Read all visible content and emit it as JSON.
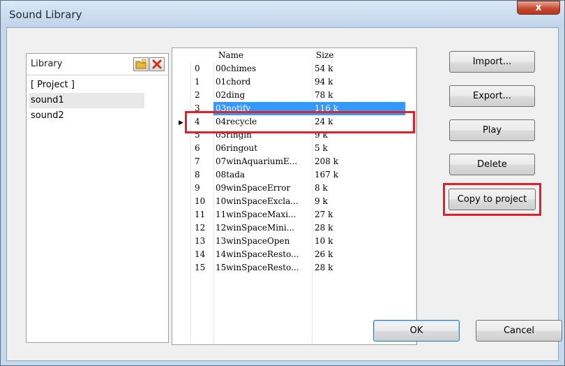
{
  "window": {
    "title": "Sound Library",
    "close_label": "x"
  },
  "library": {
    "title": "Library",
    "items": [
      "[ Project ]",
      "sound1",
      "sound2"
    ],
    "selected_index": 1
  },
  "grid": {
    "columns": [
      "Name",
      "Size"
    ],
    "selected_index": 3,
    "rows": [
      {
        "idx": "0",
        "name": "00chimes",
        "size": "54 k"
      },
      {
        "idx": "1",
        "name": "01chord",
        "size": "94 k"
      },
      {
        "idx": "2",
        "name": "02ding",
        "size": "78 k"
      },
      {
        "idx": "3",
        "name": "03notify",
        "size": "116 k"
      },
      {
        "idx": "4",
        "name": "04recycle",
        "size": "24 k"
      },
      {
        "idx": "5",
        "name": "05ringin",
        "size": "9 k"
      },
      {
        "idx": "6",
        "name": "06ringout",
        "size": "5 k"
      },
      {
        "idx": "7",
        "name": "07winAquariumE...",
        "size": "208 k"
      },
      {
        "idx": "8",
        "name": "08tada",
        "size": "167 k"
      },
      {
        "idx": "9",
        "name": "09winSpaceError",
        "size": "8 k"
      },
      {
        "idx": "10",
        "name": "10winSpaceExcla...",
        "size": "9 k"
      },
      {
        "idx": "11",
        "name": "11winSpaceMaxi...",
        "size": "27 k"
      },
      {
        "idx": "12",
        "name": "12winSpaceMini...",
        "size": "28 k"
      },
      {
        "idx": "13",
        "name": "13winSpaceOpen",
        "size": "10 k"
      },
      {
        "idx": "14",
        "name": "14winSpaceResto...",
        "size": "26 k"
      },
      {
        "idx": "15",
        "name": "15winSpaceResto...",
        "size": "28 k"
      }
    ]
  },
  "buttons": {
    "import": "Import...",
    "export": "Export...",
    "play": "Play",
    "delete": "Delete",
    "copy_to_project": "Copy to project",
    "ok": "OK",
    "cancel": "Cancel"
  },
  "colors": {
    "highlight": "#e0202a",
    "selection": "#3399ff"
  }
}
